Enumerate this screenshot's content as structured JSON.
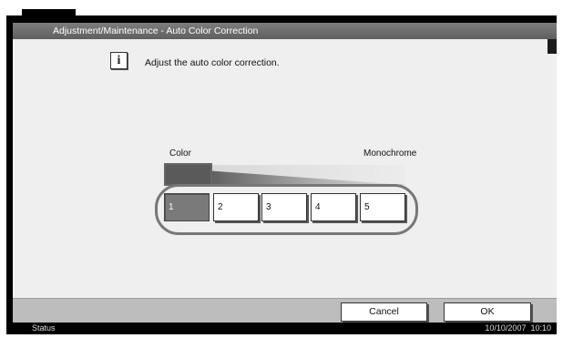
{
  "window": {
    "title": "Adjustment/Maintenance - Auto Color Correction"
  },
  "info": {
    "message": "Adjust the auto color correction."
  },
  "scale": {
    "left_label": "Color",
    "right_label": "Monochrome"
  },
  "levels": [
    "1",
    "2",
    "3",
    "4",
    "5"
  ],
  "selected_level": "1",
  "buttons": {
    "cancel": "Cancel",
    "ok": "OK"
  },
  "status_bar": {
    "status": "Status",
    "date": "10/10/2007",
    "time": "10:10"
  }
}
